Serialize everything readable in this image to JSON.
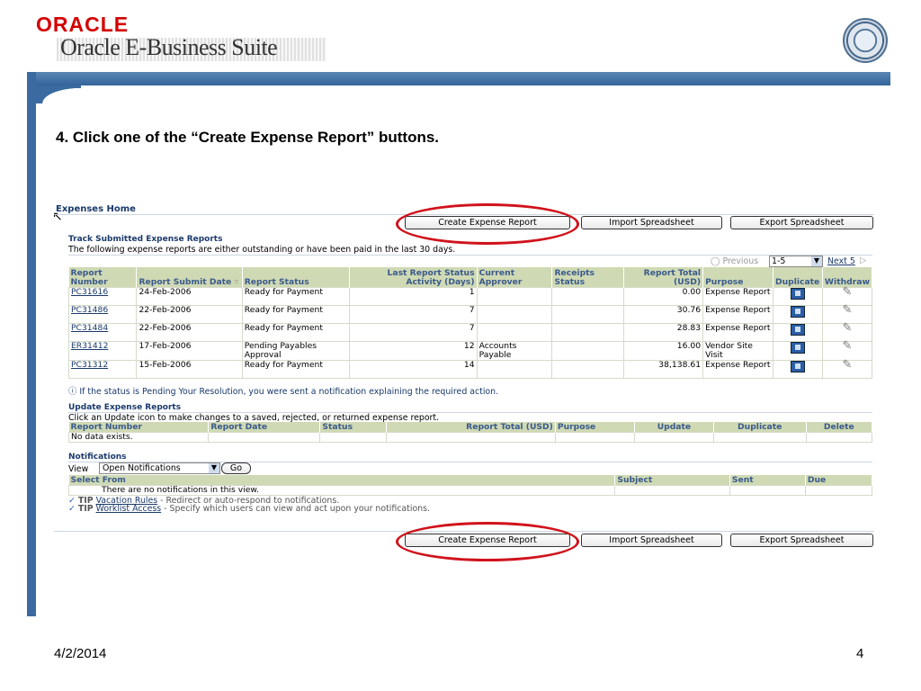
{
  "header": {
    "oracle": "ORACLE",
    "suite": "Oracle E-Business Suite"
  },
  "instruction": "4.   Click one of the “Create Expense Report” buttons.",
  "app": {
    "page_title": "Expenses Home",
    "buttons": {
      "create": "Create Expense Report",
      "import": "Import Spreadsheet",
      "export": "Export Spreadsheet"
    },
    "track": {
      "title": "Track Submitted Expense Reports",
      "desc": "The following expense reports are either outstanding or have been paid in the last 30 days.",
      "pager": {
        "previous": "Previous",
        "range": "1-5",
        "next": "Next 5"
      },
      "columns": [
        "Report Number",
        "Report Submit Date",
        "Report Status",
        "Last Report Status Activity (Days)",
        "Current Approver",
        "Receipts Status",
        "Report Total (USD)",
        "Purpose",
        "Duplicate",
        "Withdraw"
      ],
      "rows": [
        {
          "number": "PC31616",
          "date": "24-Feb-2006",
          "status": "Ready for Payment",
          "days": "1",
          "approver": "",
          "receipts": "",
          "total": "0.00",
          "purpose": "Expense Report"
        },
        {
          "number": "PC31486",
          "date": "22-Feb-2006",
          "status": "Ready for Payment",
          "days": "7",
          "approver": "",
          "receipts": "",
          "total": "30.76",
          "purpose": "Expense Report"
        },
        {
          "number": "PC31484",
          "date": "22-Feb-2006",
          "status": "Ready for Payment",
          "days": "7",
          "approver": "",
          "receipts": "",
          "total": "28.83",
          "purpose": "Expense Report"
        },
        {
          "number": "ER31412",
          "date": "17-Feb-2006",
          "status": "Pending Payables Approval",
          "days": "12",
          "approver": "Accounts Payable",
          "receipts": "",
          "total": "16.00",
          "purpose": "Vendor Site Visit"
        },
        {
          "number": "PC31312",
          "date": "15-Feb-2006",
          "status": "Ready for Payment",
          "days": "14",
          "approver": "",
          "receipts": "",
          "total": "38,138.61",
          "purpose": "Expense Report"
        }
      ],
      "info": "If the status is Pending Your Resolution, you were sent a notification explaining the required action."
    },
    "update": {
      "title": "Update Expense Reports",
      "desc": "Click an Update icon to make changes to a saved, rejected, or returned expense report.",
      "columns": [
        "Report Number",
        "Report Date",
        "Status",
        "Report Total (USD)",
        "Purpose",
        "Update",
        "Duplicate",
        "Delete"
      ],
      "empty": "No data exists."
    },
    "notifications": {
      "title": "Notifications",
      "view_label": "View",
      "view_value": "Open Notifications",
      "go": "Go",
      "columns": [
        "Select From",
        "Subject",
        "Sent",
        "Due"
      ],
      "empty": "There are no notifications in this view.",
      "tip1_label": "TIP",
      "tip1_link": "Vacation Rules",
      "tip1_text": " - Redirect or auto-respond to notifications.",
      "tip2_label": "TIP",
      "tip2_link": "Worklist Access",
      "tip2_text": " - Specify which users can view and act upon your notifications."
    }
  },
  "footer": {
    "date": "4/2/2014",
    "page": "4"
  },
  "colors": {
    "accent_red": "#d0121b",
    "header_blue": "#3a6a9f",
    "table_header": "#cfd9b4"
  }
}
